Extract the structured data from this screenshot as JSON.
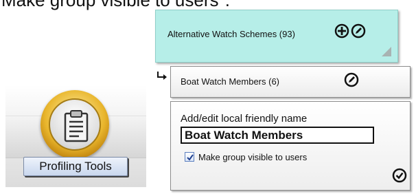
{
  "caption": "Make group visible to users\".",
  "profiling_tools": {
    "label": "Profiling Tools",
    "icon": "clipboard-icon"
  },
  "schemes_panel": {
    "title": "Alternative Watch Schemes (93)",
    "icons": [
      "add-circle-icon",
      "edit-pencil-icon"
    ],
    "background": "#b6eee8"
  },
  "members_panel": {
    "title": "Boat Watch Members (6)",
    "icons": [
      "edit-pencil-icon"
    ]
  },
  "edit_panel": {
    "field_label": "Add/edit local friendly name",
    "name_value": "Boat Watch Members",
    "visible_label": "Make group visible to users",
    "visible_checked": true,
    "confirm_icon": "check-circle-icon"
  }
}
